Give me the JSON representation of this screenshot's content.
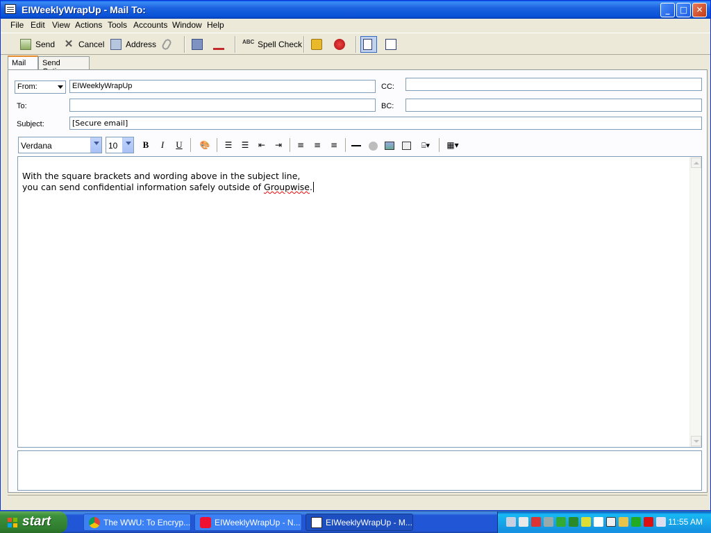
{
  "window": {
    "title": "EIWeeklyWrapUp - Mail To:"
  },
  "titlebar_buttons": {
    "minimize": "_",
    "maximize": "□",
    "close": "✕"
  },
  "menu": [
    "File",
    "Edit",
    "View",
    "Actions",
    "Tools",
    "Accounts",
    "Window",
    "Help"
  ],
  "toolbar": {
    "send": "Send",
    "cancel": "Cancel",
    "address": "Address",
    "spell_check": "Spell Check"
  },
  "tabs": [
    "Mail",
    "Send Options"
  ],
  "header": {
    "from_label": "From:",
    "from_value": "EIWeeklyWrapUp",
    "to_label": "To:",
    "to_value": "",
    "cc_label": "CC:",
    "cc_value": "",
    "bc_label": "BC:",
    "bc_value": "",
    "subject_label": "Subject:",
    "subject_value": "[Secure email]"
  },
  "format": {
    "font": "Verdana",
    "size": "10",
    "bold": "B",
    "italic": "I",
    "underline": "U"
  },
  "message": {
    "line1": "With the square brackets and wording above in the subject line,",
    "line2_prefix": "you can send confidential information safely outside of ",
    "line2_word": "Groupwise",
    "line2_suffix": "."
  },
  "taskbar": {
    "start": "start",
    "tasks": [
      "The WWU: To Encryp...",
      "EIWeeklyWrapUp - N...",
      "EIWeeklyWrapUp - M..."
    ],
    "clock": "11:55 AM"
  },
  "colors": {
    "title_blue": "#0850d6",
    "taskbar_blue": "#2157d7",
    "start_green": "#3c8f3c",
    "accent_orange": "#e68b2c",
    "spell_error_red": "#e00000"
  }
}
